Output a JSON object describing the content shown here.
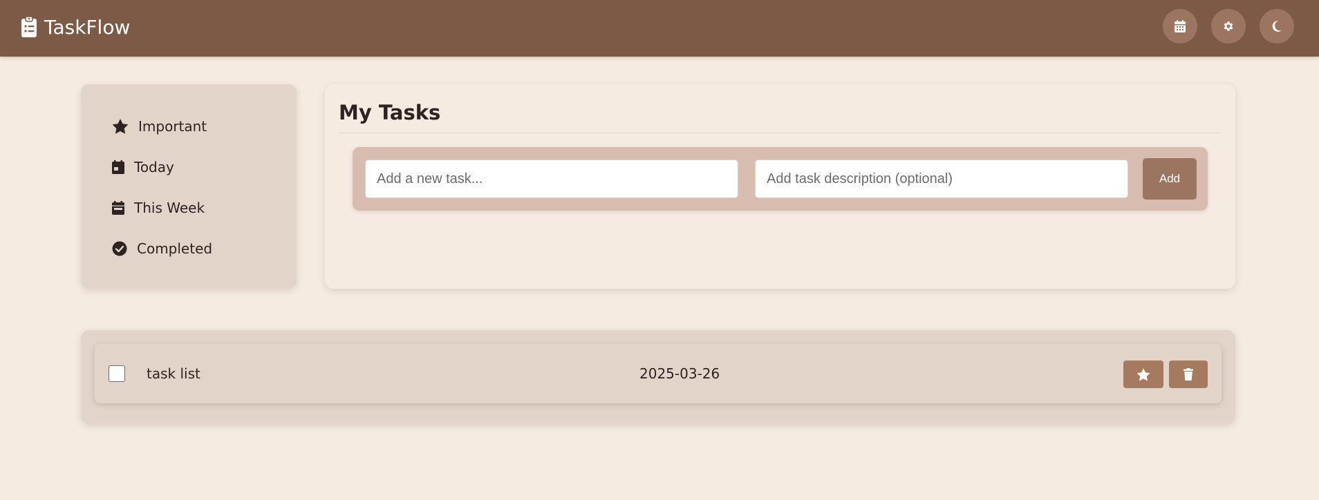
{
  "app": {
    "title": "TaskFlow"
  },
  "header": {
    "buttons": [
      {
        "icon": "calendar-icon"
      },
      {
        "icon": "gear-icon"
      },
      {
        "icon": "moon-icon"
      }
    ]
  },
  "sidebar": {
    "items": [
      {
        "label": "Important",
        "icon": "star-icon"
      },
      {
        "label": "Today",
        "icon": "calendar-day-icon"
      },
      {
        "label": "This Week",
        "icon": "calendar-week-icon"
      },
      {
        "label": "Completed",
        "icon": "check-circle-icon"
      }
    ]
  },
  "main": {
    "title": "My Tasks",
    "task_input": {
      "placeholder": "Add a new task...",
      "value": ""
    },
    "description_input": {
      "placeholder": "Add task description (optional)",
      "value": ""
    },
    "add_label": "Add"
  },
  "tasks": [
    {
      "title": "task list",
      "date": "2025-03-26",
      "completed": false
    }
  ],
  "colors": {
    "header": "#7d5a45",
    "background": "#f5ebe1",
    "panel": "#e2d4c8",
    "accent": "#9b7560",
    "add_bar": "#d9bcb0",
    "row_button": "#a57a5e"
  }
}
